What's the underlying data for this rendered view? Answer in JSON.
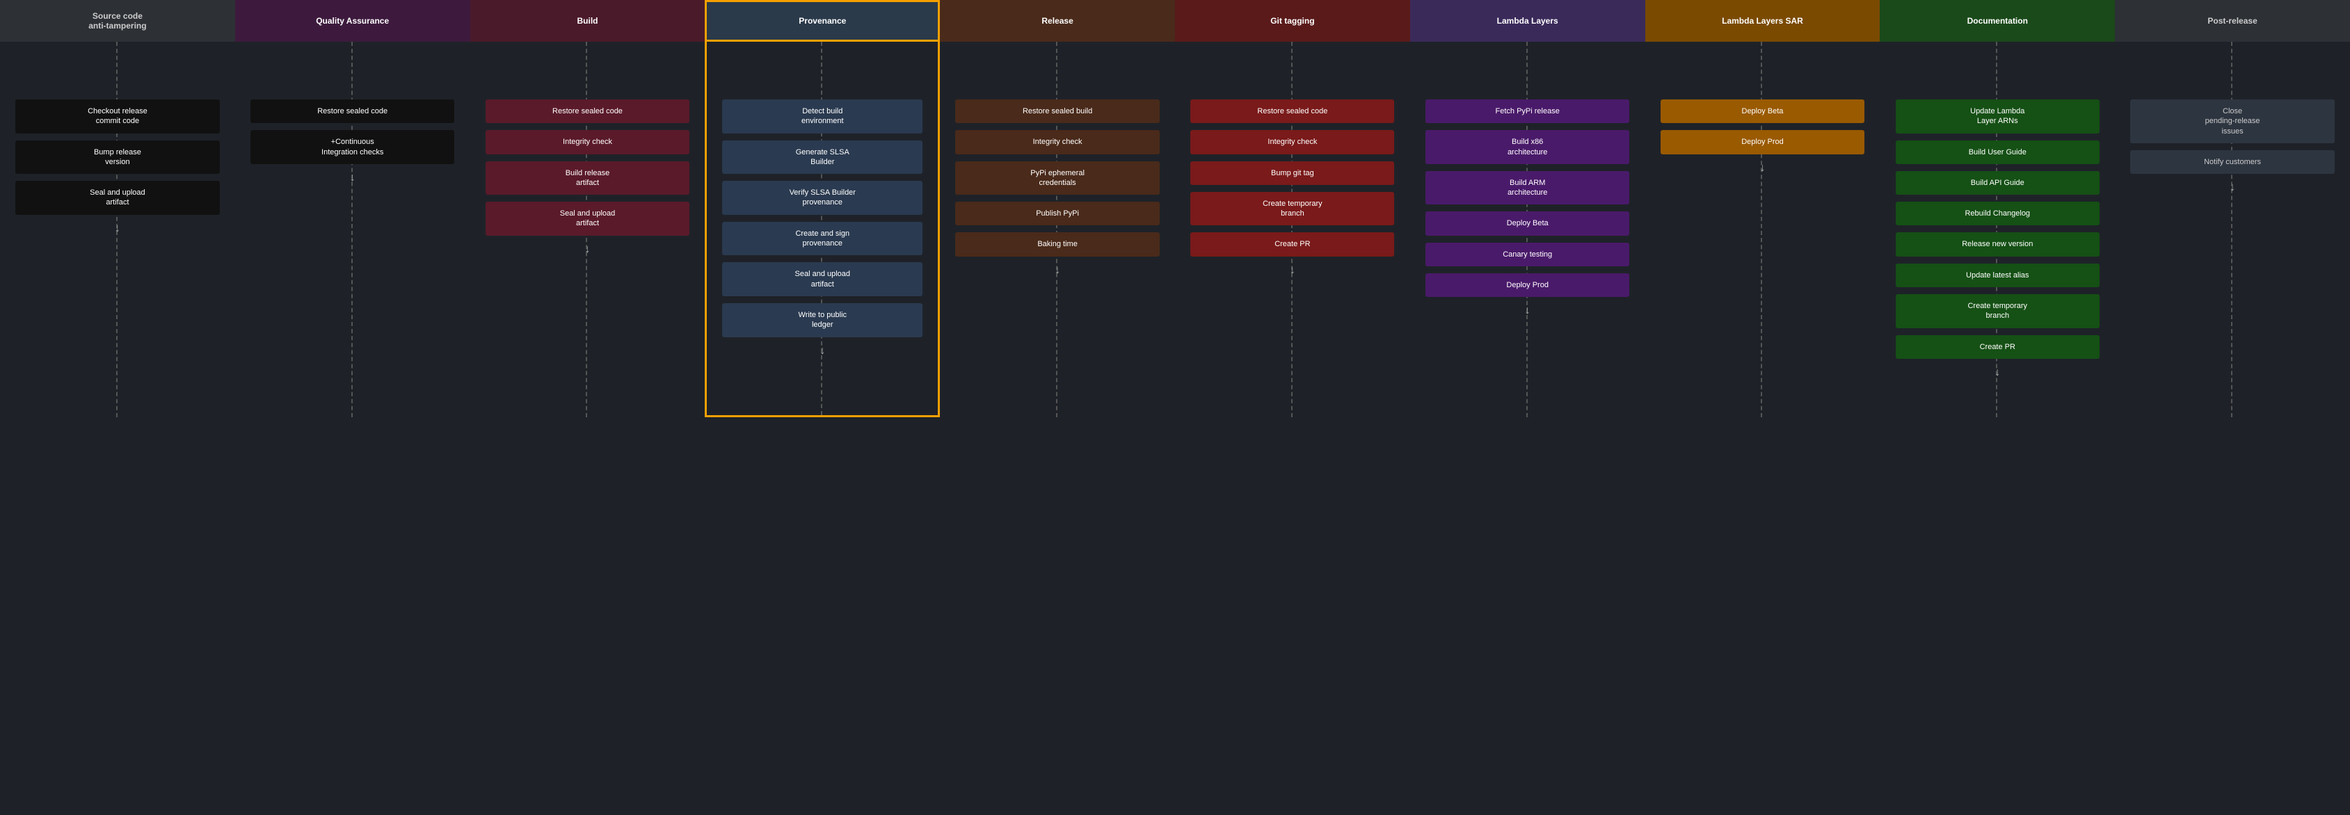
{
  "columns": [
    {
      "id": "source",
      "header": "Source code\nanti-tampering",
      "colorClass": "col-source",
      "tasks": [
        {
          "label": "Checkout release\ncommit code",
          "style": "black",
          "offset": 160
        },
        {
          "label": "Bump release\nversion",
          "style": "black",
          "offset": 0
        },
        {
          "label": "Seal and upload\nartifact",
          "style": "black",
          "offset": 0
        }
      ]
    },
    {
      "id": "qa",
      "header": "Quality Assurance",
      "colorClass": "col-qa",
      "tasks": [
        {
          "label": "Restore sealed code",
          "style": "black",
          "offset": 160
        },
        {
          "label": "+Continuous\nIntegration checks",
          "style": "black",
          "offset": 0
        }
      ]
    },
    {
      "id": "build",
      "header": "Build",
      "colorClass": "col-build",
      "tasks": [
        {
          "label": "Restore sealed code",
          "style": "maroon",
          "offset": 160
        },
        {
          "label": "Integrity check",
          "style": "maroon",
          "offset": 0
        },
        {
          "label": "Build release\nartifact",
          "style": "maroon",
          "offset": 0
        },
        {
          "label": "Seal and upload\nartifact",
          "style": "maroon",
          "offset": 0
        }
      ]
    },
    {
      "id": "provenance",
      "header": "Provenance",
      "colorClass": "col-provenance",
      "tasks": [
        {
          "label": "Detect build\nenvironment",
          "style": "blue-gray",
          "offset": 160
        },
        {
          "label": "Generate SLSA\nBuilder",
          "style": "blue-gray",
          "offset": 0
        },
        {
          "label": "Verify SLSA Builder\nprovenance",
          "style": "blue-gray",
          "offset": 0
        },
        {
          "label": "Create and sign\nprovenance",
          "style": "blue-gray",
          "offset": 0
        },
        {
          "label": "Seal and upload\nartifact",
          "style": "blue-gray",
          "offset": 0
        },
        {
          "label": "Write to public\nledger",
          "style": "blue-gray",
          "offset": 0
        }
      ]
    },
    {
      "id": "release",
      "header": "Release",
      "colorClass": "col-release",
      "tasks": [
        {
          "label": "Restore sealed build",
          "style": "brown",
          "offset": 160
        },
        {
          "label": "Integrity check",
          "style": "brown",
          "offset": 0
        },
        {
          "label": "PyPi ephemeral\ncredentials",
          "style": "brown",
          "offset": 0
        },
        {
          "label": "Publish PyPi",
          "style": "brown",
          "offset": 0
        },
        {
          "label": "Baking time",
          "style": "brown",
          "offset": 0
        }
      ]
    },
    {
      "id": "git",
      "header": "Git tagging",
      "colorClass": "col-git",
      "tasks": [
        {
          "label": "Restore sealed code",
          "style": "red-dark",
          "offset": 160
        },
        {
          "label": "Integrity check",
          "style": "red-dark",
          "offset": 0
        },
        {
          "label": "Bump git tag",
          "style": "red-dark",
          "offset": 0
        },
        {
          "label": "Create temporary\nbranch",
          "style": "red-dark",
          "offset": 0
        },
        {
          "label": "Create PR",
          "style": "red-dark",
          "offset": 0
        }
      ]
    },
    {
      "id": "lambda",
      "header": "Lambda Layers",
      "colorClass": "col-lambda",
      "tasks": [
        {
          "label": "Fetch PyPi release",
          "style": "purple",
          "offset": 160
        },
        {
          "label": "Build x86\narchitecture",
          "style": "purple",
          "offset": 0
        },
        {
          "label": "Build ARM\narchitecture",
          "style": "purple",
          "offset": 0
        },
        {
          "label": "Deploy Beta",
          "style": "purple",
          "offset": 0
        },
        {
          "label": "Canary testing",
          "style": "purple",
          "offset": 0
        },
        {
          "label": "Deploy Prod",
          "style": "purple",
          "offset": 0
        }
      ]
    },
    {
      "id": "lambda-sar",
      "header": "Lambda Layers SAR",
      "colorClass": "col-lambda-sar",
      "tasks": [
        {
          "label": "Deploy Beta",
          "style": "orange",
          "offset": 160
        },
        {
          "label": "Deploy Prod",
          "style": "orange",
          "offset": 0
        }
      ]
    },
    {
      "id": "docs",
      "header": "Documentation",
      "colorClass": "col-docs",
      "tasks": [
        {
          "label": "Update Lambda\nLayer ARNs",
          "style": "dark-green",
          "offset": 160
        },
        {
          "label": "Build User Guide",
          "style": "dark-green",
          "offset": 0
        },
        {
          "label": "Build API Guide",
          "style": "dark-green",
          "offset": 0
        },
        {
          "label": "Rebuild Changelog",
          "style": "dark-green",
          "offset": 0
        },
        {
          "label": "Release new version",
          "style": "dark-green",
          "offset": 0
        },
        {
          "label": "Update latest alias",
          "style": "dark-green",
          "offset": 0
        },
        {
          "label": "Create temporary\nbranch",
          "style": "dark-green",
          "offset": 0
        },
        {
          "label": "Create PR",
          "style": "dark-green",
          "offset": 0
        }
      ]
    },
    {
      "id": "postrelease",
      "header": "Post-release",
      "colorClass": "col-postrelease",
      "tasks": [
        {
          "label": "Close\npending-release\nissues",
          "style": "dark-gray",
          "offset": 160
        },
        {
          "label": "Notify customers",
          "style": "dark-gray",
          "offset": 0
        }
      ]
    }
  ]
}
